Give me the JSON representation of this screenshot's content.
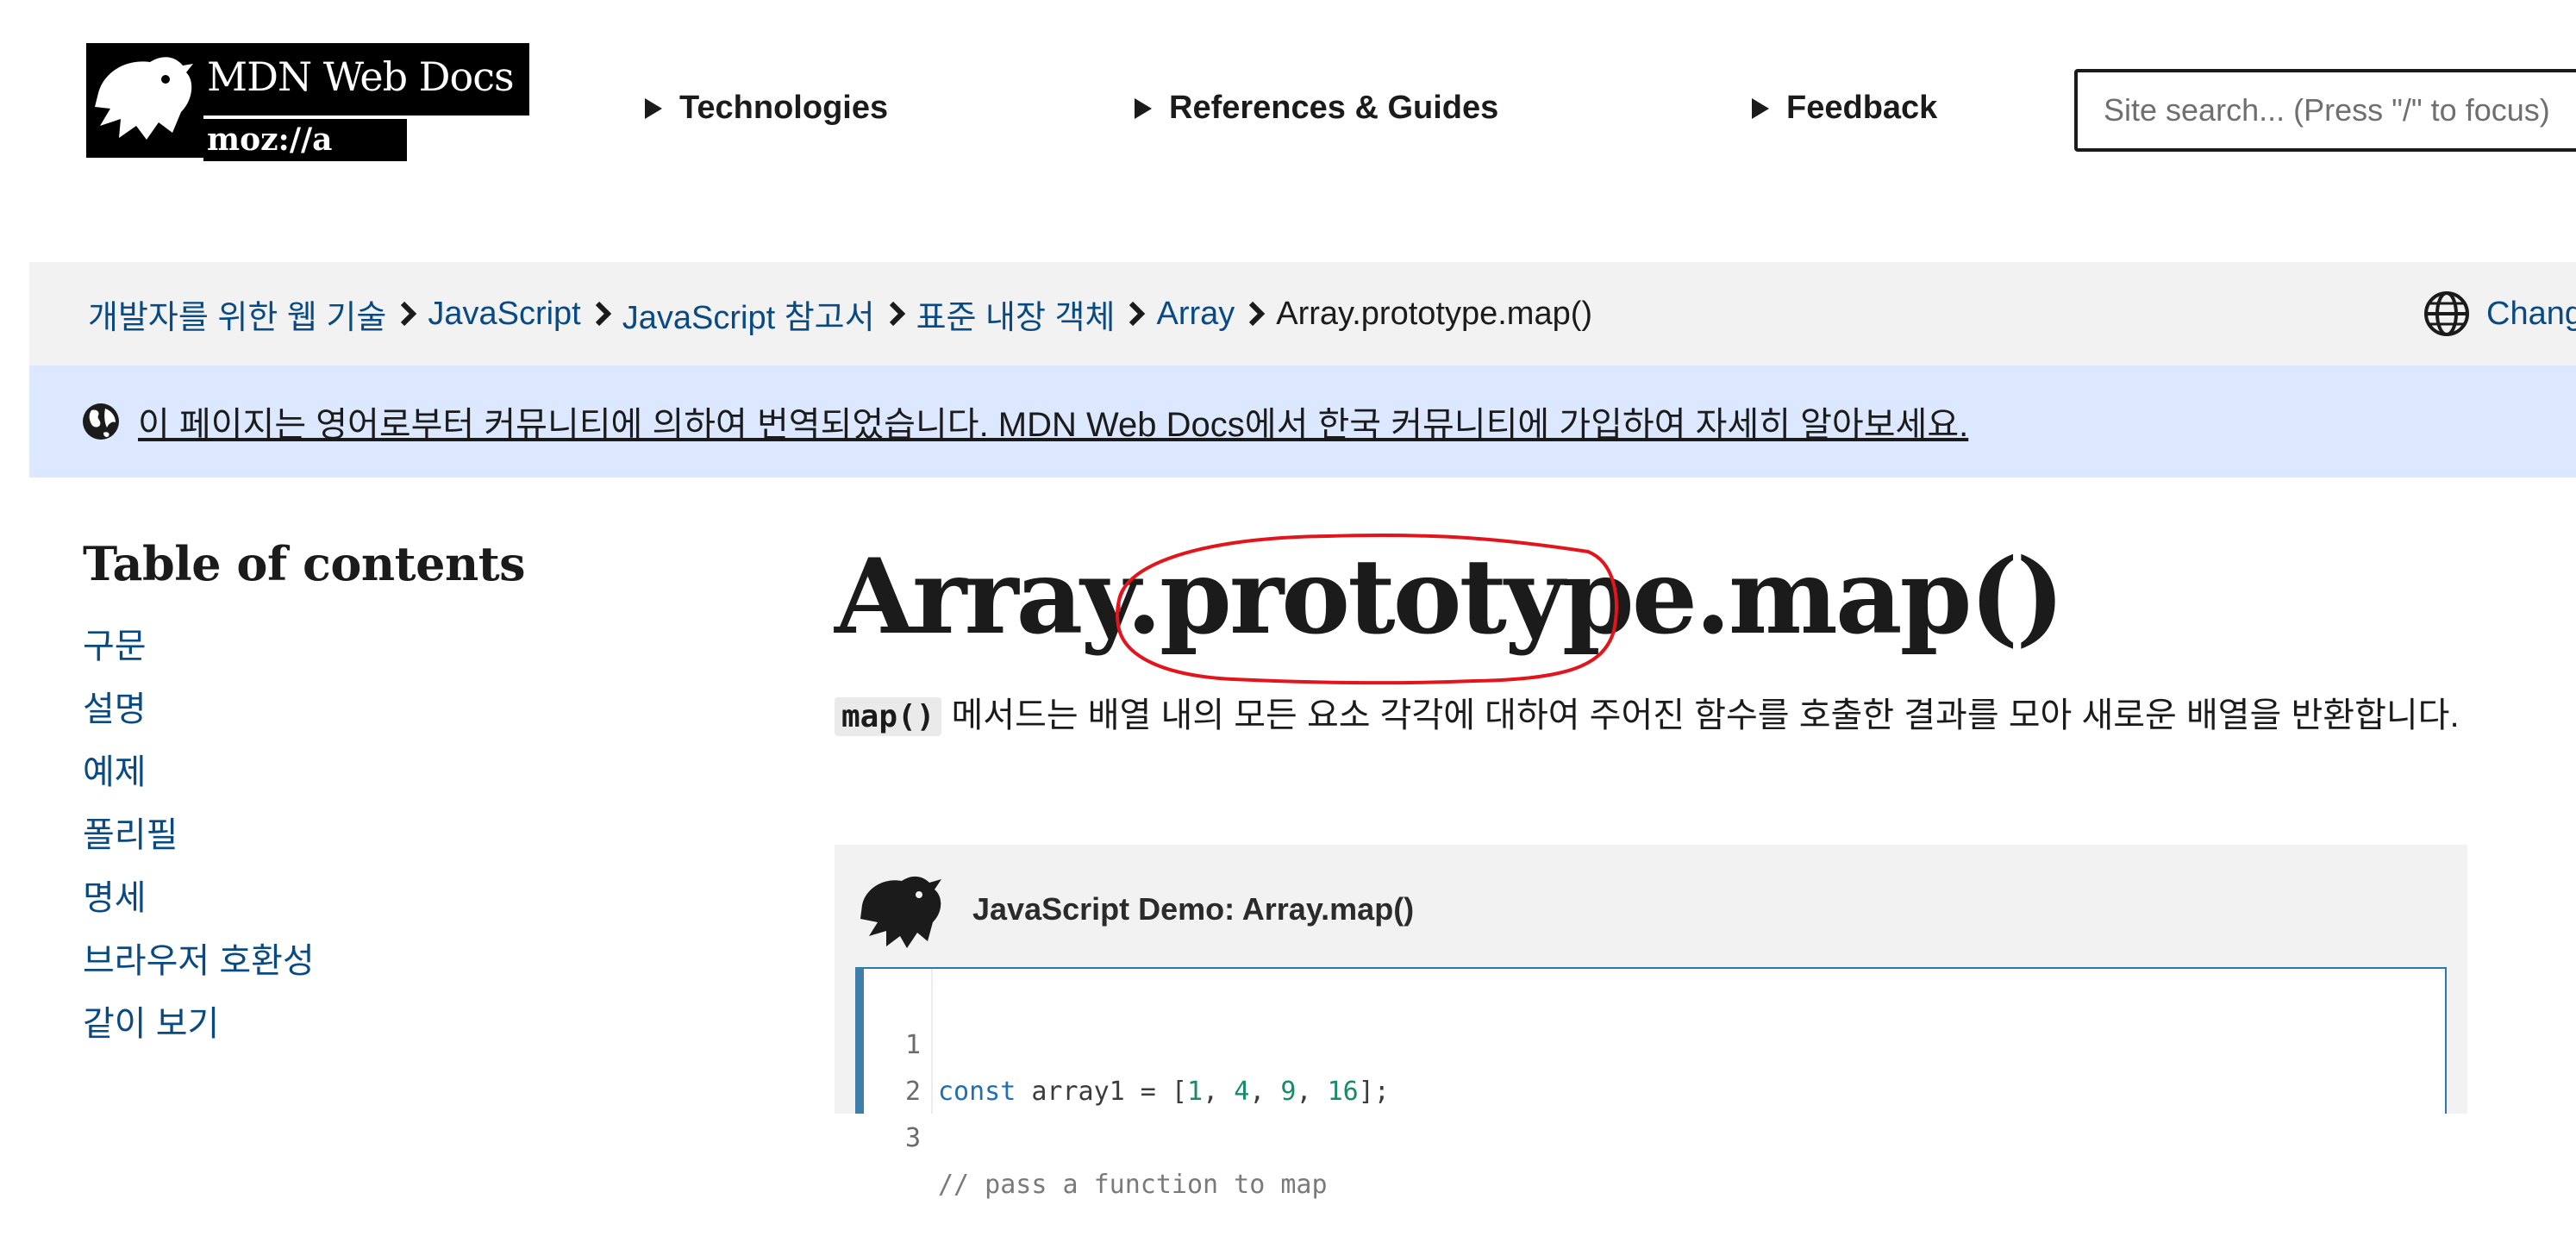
{
  "header": {
    "logo": {
      "title": "MDN Web Docs",
      "sub": "moz://a"
    },
    "nav": [
      {
        "label": "Technologies"
      },
      {
        "label": "References & Guides"
      },
      {
        "label": "Feedback"
      }
    ],
    "search": {
      "placeholder": "Site search... (Press \"/\" to focus)"
    }
  },
  "breadcrumbs": {
    "items": [
      {
        "label": "개발자를 위한 웹 기술"
      },
      {
        "label": "JavaScript"
      },
      {
        "label": "JavaScript 참고서"
      },
      {
        "label": "표준 내장 객체"
      },
      {
        "label": "Array"
      }
    ],
    "current": "Array.prototype.map()",
    "language_label": "Change"
  },
  "notice": {
    "text": "이 페이지는 영어로부터 커뮤니티에 의하여 번역되었습니다. MDN Web Docs에서 한국 커뮤니티에 가입하여 자세히 알아보세요."
  },
  "toc": {
    "title": "Table of contents",
    "items": [
      {
        "label": "구문"
      },
      {
        "label": "설명"
      },
      {
        "label": "예제"
      },
      {
        "label": "폴리필"
      },
      {
        "label": "명세"
      },
      {
        "label": "브라우저 호환성"
      },
      {
        "label": "같이 보기"
      }
    ]
  },
  "article": {
    "title": "Array.prototype.map()",
    "summary_code": "map()",
    "summary_text": " 메서드는 배열 내의 모든 요소 각각에 대하여 주어진 함수를 호출한 결과를 모아 새로운 배열을 반환합니다.",
    "annotation_color": "#e3141b"
  },
  "demo": {
    "title": "JavaScript Demo: Array.map()",
    "lines": [
      {
        "n": "1",
        "keyword": "const",
        "rest_a": " array1 = [",
        "nums": [
          "1",
          "4",
          "9",
          "16"
        ],
        "rest_b": "];"
      },
      {
        "n": "2",
        "text": ""
      },
      {
        "n": "3",
        "comment": "// pass a function to map"
      }
    ]
  }
}
